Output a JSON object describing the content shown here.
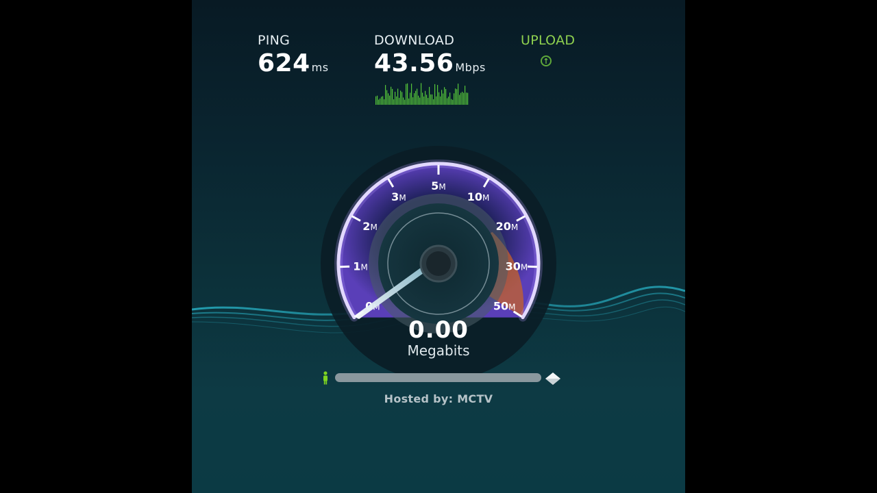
{
  "ping": {
    "label": "PING",
    "value": "624",
    "unit": "ms"
  },
  "download": {
    "label": "DOWNLOAD",
    "value": "43.56",
    "unit": "Mbps"
  },
  "upload": {
    "label": "UPLOAD",
    "icon": "arrow-up-circle-icon"
  },
  "gauge": {
    "ticks": [
      {
        "num": "0",
        "suffix": "M"
      },
      {
        "num": "1",
        "suffix": "M"
      },
      {
        "num": "2",
        "suffix": "M"
      },
      {
        "num": "3",
        "suffix": "M"
      },
      {
        "num": "5",
        "suffix": "M"
      },
      {
        "num": "10",
        "suffix": "M"
      },
      {
        "num": "20",
        "suffix": "M"
      },
      {
        "num": "30",
        "suffix": "M"
      },
      {
        "num": "50",
        "suffix": "M"
      }
    ],
    "needle_value_mbps": 0,
    "colors": {
      "arc": "#a98cf0",
      "fill_purple": "#4a3aa0",
      "fill_orange": "#c7632a",
      "needle": "#cfe9f5"
    }
  },
  "speed": {
    "value": "0.00",
    "unit": "Megabits"
  },
  "progress": {
    "fraction": 0.0,
    "user_icon": "person-icon",
    "server_icon": "server-icon"
  },
  "hosted_by": "Hosted by: MCTV",
  "accent": {
    "green": "#8fd14f",
    "wave": "#2fd0e6"
  }
}
